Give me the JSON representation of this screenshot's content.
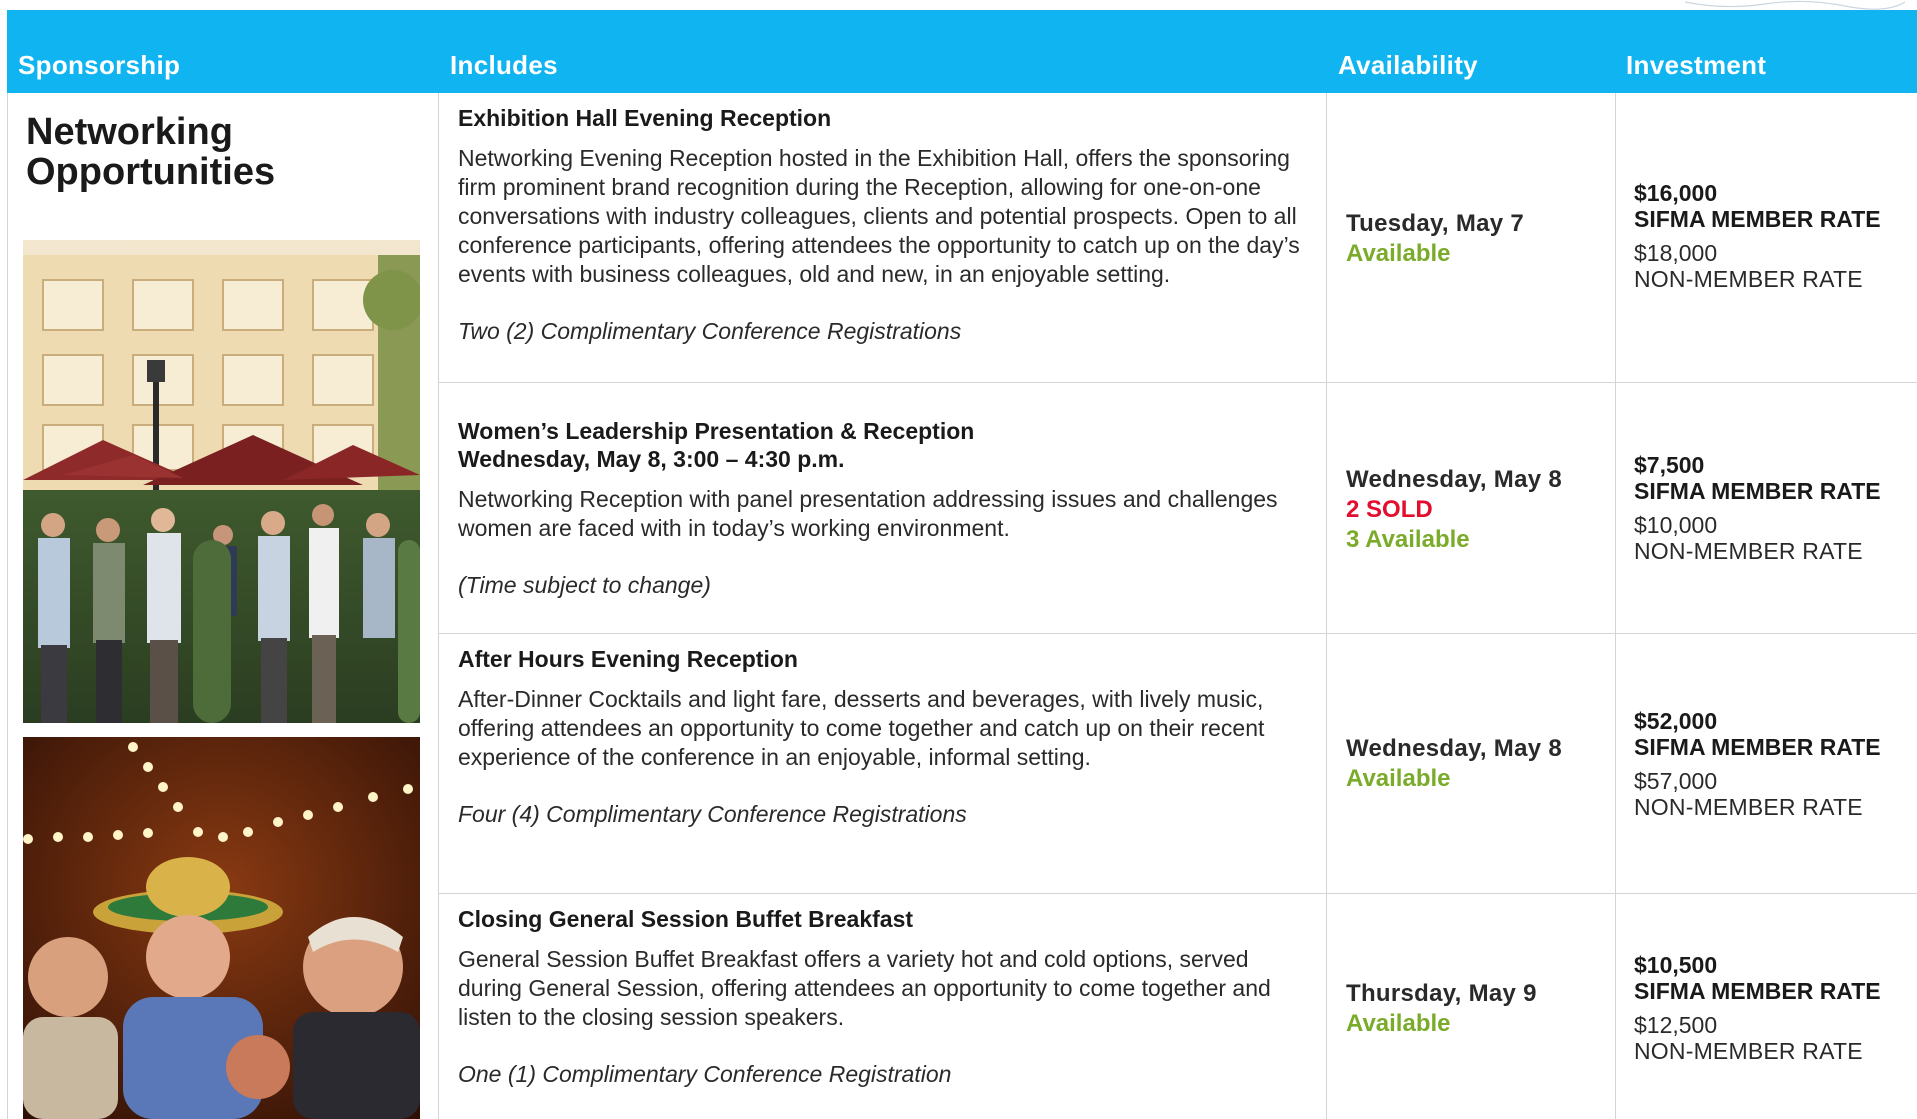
{
  "header": {
    "sponsorship": "Sponsorship",
    "includes": "Includes",
    "availability": "Availability",
    "investment": "Investment"
  },
  "section_title": "Networking Opportunities",
  "photos": [
    {
      "name": "reception-photo"
    },
    {
      "name": "evening-party-photo"
    }
  ],
  "rows": [
    {
      "title": "Exhibition Hall Evening Reception",
      "subtitle": "",
      "description": "Networking Evening Reception hosted in the Exhibition Hall, offers the sponsoring firm prominent brand recognition during the Reception, allowing for one-on-one conversations with industry colleagues, clients and potential prospects. Open to all conference participants, offering attendees the opportunity to catch up on the day’s events with business colleagues, old and new, in an enjoyable setting.",
      "note": "Two (2) Complimentary Conference Registrations",
      "day": "Tuesday, May 7",
      "sold": "",
      "available": "Available",
      "member_price": "$16,000",
      "member_label": "SIFMA MEMBER RATE",
      "nonmember_price": "$18,000",
      "nonmember_label": "NON-MEMBER RATE"
    },
    {
      "title": "Women’s Leadership Presentation & Reception",
      "subtitle": "Wednesday, May 8, 3:00 – 4:30 p.m.",
      "description": "Networking Reception with panel presentation addressing issues and challenges women are faced with in today’s working environment.",
      "note": "(Time subject to change)",
      "day": "Wednesday, May 8",
      "sold": "2 SOLD",
      "available": "3 Available",
      "member_price": "$7,500",
      "member_label": "SIFMA MEMBER RATE",
      "nonmember_price": "$10,000",
      "nonmember_label": "NON-MEMBER RATE"
    },
    {
      "title": "After Hours Evening Reception",
      "subtitle": "",
      "description": "After-Dinner Cocktails and light fare, desserts and beverages, with lively music, offering attendees an opportunity to come together and catch up on their recent experience of the conference in an enjoyable, informal setting.",
      "note": "Four (4) Complimentary Conference Registrations",
      "day": "Wednesday, May 8",
      "sold": "",
      "available": "Available",
      "member_price": "$52,000",
      "member_label": "SIFMA MEMBER RATE",
      "nonmember_price": "$57,000",
      "nonmember_label": "NON-MEMBER RATE"
    },
    {
      "title": "Closing General Session Buffet Breakfast",
      "subtitle": "",
      "description": "General Session Buffet Breakfast offers a variety hot and cold options, served during General Session, offering attendees an opportunity to come together and listen to the closing session speakers.",
      "note": "One (1) Complimentary Conference Registration",
      "day": "Thursday, May 9",
      "sold": "",
      "available": "Available",
      "member_price": "$10,500",
      "member_label": "SIFMA MEMBER RATE",
      "nonmember_price": "$12,500",
      "nonmember_label": "NON-MEMBER RATE"
    }
  ],
  "colors": {
    "header_bg": "#0fb4f0",
    "available_green": "#7aab2a",
    "sold_red": "#e30d2d"
  }
}
